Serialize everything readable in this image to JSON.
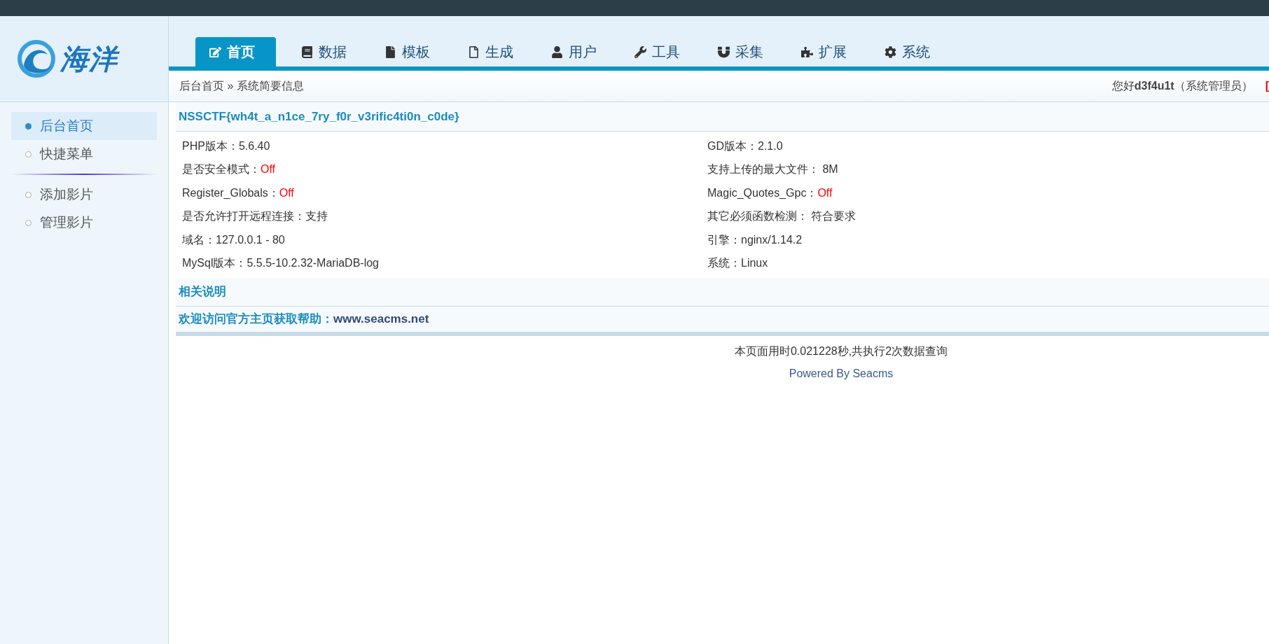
{
  "logo": {
    "text": "海洋"
  },
  "tabs": [
    {
      "label": "首页",
      "selected": true
    },
    {
      "label": "数据",
      "selected": false
    },
    {
      "label": "模板",
      "selected": false
    },
    {
      "label": "生成",
      "selected": false
    },
    {
      "label": "用户",
      "selected": false
    },
    {
      "label": "工具",
      "selected": false
    },
    {
      "label": "采集",
      "selected": false
    },
    {
      "label": "扩展",
      "selected": false
    },
    {
      "label": "系统",
      "selected": false
    }
  ],
  "breadcrumb": "后台首页 » 系统简要信息",
  "user": {
    "greeting": "您好**d3f4u1t**（系统管理员）",
    "logout": "["
  },
  "sidebar": {
    "groups": [
      [
        {
          "label": "后台首页",
          "selected": true
        },
        {
          "label": "快捷菜单",
          "selected": false
        }
      ],
      [
        {
          "label": "添加影片",
          "selected": false
        },
        {
          "label": "管理影片",
          "selected": false
        }
      ]
    ]
  },
  "info": {
    "title": "NSSCTF{wh4t_a_n1ce_7ry_f0r_v3rific4ti0n_c0de}",
    "items": [
      {
        "label": "PHP版本：",
        "value": "5.6.40",
        "alert": false
      },
      {
        "label": "GD版本：",
        "value": "2.1.0",
        "alert": false
      },
      {
        "label": "是否安全模式：",
        "value": "Off",
        "alert": true
      },
      {
        "label": "支持上传的最大文件： ",
        "value": "8M",
        "alert": false
      },
      {
        "label": "Register_Globals：",
        "value": "Off",
        "alert": true
      },
      {
        "label": "Magic_Quotes_Gpc：",
        "value": "Off",
        "alert": true
      },
      {
        "label": "是否允许打开远程连接：",
        "value": "支持",
        "alert": false
      },
      {
        "label": "其它必须函数检测： ",
        "value": "符合要求",
        "alert": false
      },
      {
        "label": "域名：",
        "value": "127.0.0.1 - 80",
        "alert": false
      },
      {
        "label": "引擎：",
        "value": "nginx/1.14.2",
        "alert": false
      },
      {
        "label": "MySql版本：",
        "value": "5.5.5-10.2.32-MariaDB-log",
        "alert": false
      },
      {
        "label": "系统：",
        "value": "Linux",
        "alert": false
      }
    ]
  },
  "notes_title": "相关说明",
  "help": {
    "text": "欢迎访问官方主页获取帮助：",
    "link": "www.seacms.net"
  },
  "footer": {
    "timing": "本页面用时0.021228秒,共执行2次数据查询",
    "powered": "Powered By Seacms"
  }
}
